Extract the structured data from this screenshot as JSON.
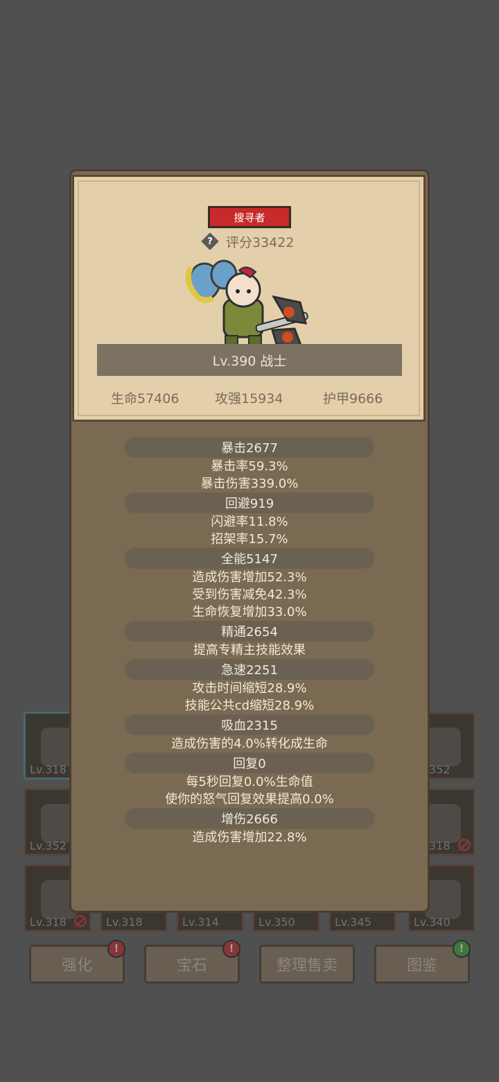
{
  "inventory": {
    "left_col": [
      {
        "level": "Lv.318",
        "teal": true,
        "banned": false
      },
      {
        "level": "Lv.352",
        "teal": false,
        "banned": false
      },
      {
        "level": "Lv.318",
        "teal": false,
        "banned": true
      }
    ],
    "right_col": [
      {
        "level": "352",
        "banned": false
      },
      {
        "level": "318",
        "banned": true
      },
      {
        "level": "Lv.340",
        "banned": false
      }
    ],
    "bottom_row": [
      "Lv.318",
      "Lv.314",
      "Lv.350",
      "Lv.345"
    ]
  },
  "bottom_buttons": [
    {
      "label": "强化",
      "badge": "!",
      "badge_color": "red"
    },
    {
      "label": "宝石",
      "badge": "!",
      "badge_color": "red"
    },
    {
      "label": "整理售卖",
      "badge": "",
      "badge_color": ""
    },
    {
      "label": "图鉴",
      "badge": "!",
      "badge_color": "green"
    }
  ],
  "card": {
    "rank": "搜寻者",
    "help_icon": "?",
    "score": "评分33422",
    "level_class": "Lv.390 战士",
    "hp": "生命57406",
    "attack": "攻强15934",
    "armor": "护甲9666"
  },
  "stats": [
    {
      "head": "暴击2677",
      "lines": [
        "暴击率59.3%",
        "暴击伤害339.0%"
      ]
    },
    {
      "head": "回避919",
      "lines": [
        "闪避率11.8%",
        "招架率15.7%"
      ]
    },
    {
      "head": "全能5147",
      "lines": [
        "造成伤害增加52.3%",
        "受到伤害减免42.3%",
        "生命恢复增加33.0%"
      ]
    },
    {
      "head": "精通2654",
      "lines": [
        "提高专精主技能效果"
      ]
    },
    {
      "head": "急速2251",
      "lines": [
        "攻击时间缩短28.9%",
        "技能公共cd缩短28.9%"
      ]
    },
    {
      "head": "吸血2315",
      "lines": [
        "造成伤害的4.0%转化成生命"
      ]
    },
    {
      "head": "回复0",
      "lines": [
        "每5秒回复0.0%生命值",
        "使你的怒气回复效果提高0.0%"
      ]
    },
    {
      "head": "增伤2666",
      "lines": [
        "造成伤害增加22.8%"
      ]
    }
  ]
}
